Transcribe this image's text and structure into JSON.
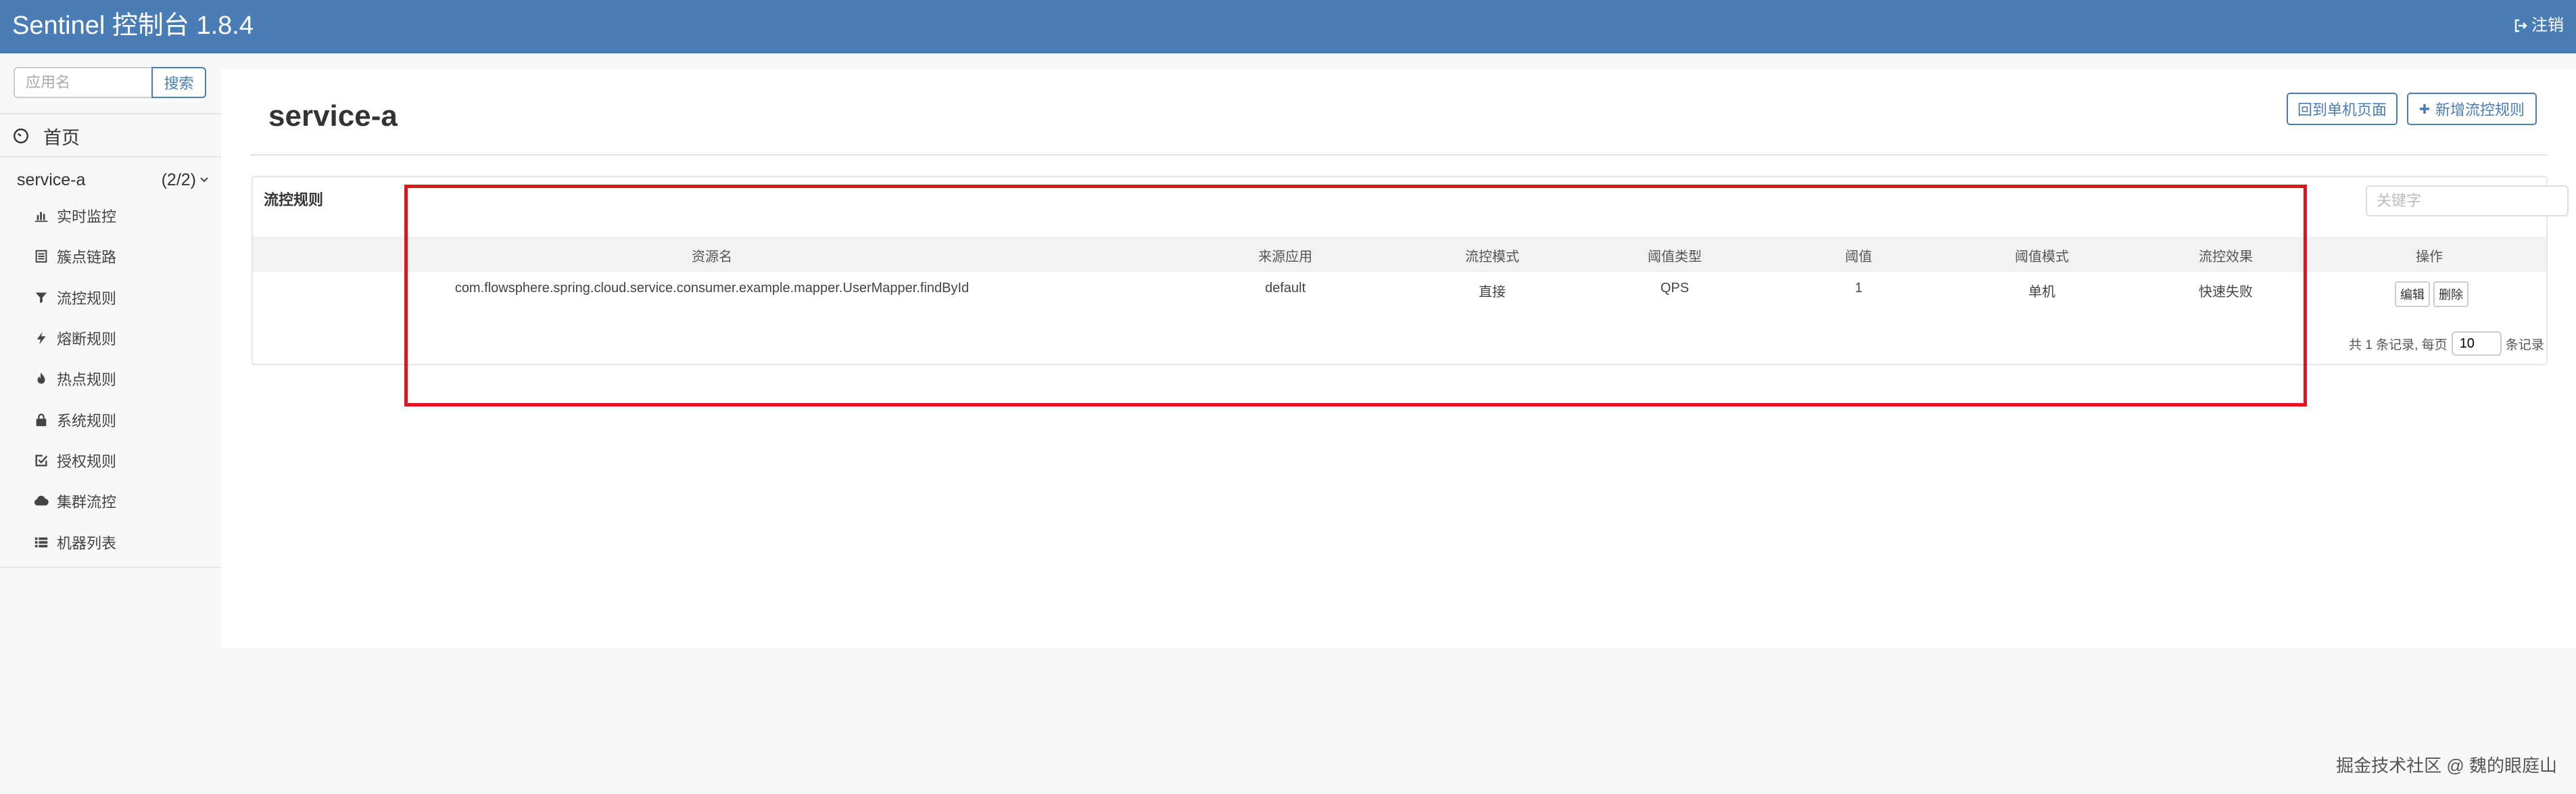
{
  "header": {
    "brand": "Sentinel 控制台 1.8.4",
    "logout_label": "注销"
  },
  "sidebar": {
    "search_placeholder": "应用名",
    "search_button": "搜索",
    "home_label": "首页",
    "app": {
      "name": "service-a",
      "count": "(2/2)"
    },
    "menu": [
      {
        "label": "实时监控",
        "icon": "bar-chart-icon"
      },
      {
        "label": "簇点链路",
        "icon": "list-icon"
      },
      {
        "label": "流控规则",
        "icon": "filter-icon"
      },
      {
        "label": "熔断规则",
        "icon": "flash-icon"
      },
      {
        "label": "热点规则",
        "icon": "fire-icon"
      },
      {
        "label": "系统规则",
        "icon": "lock-icon"
      },
      {
        "label": "授权规则",
        "icon": "check-square-icon"
      },
      {
        "label": "集群流控",
        "icon": "cloud-icon"
      },
      {
        "label": "机器列表",
        "icon": "list-icon"
      }
    ]
  },
  "main": {
    "title": "service-a",
    "back_button": "回到单机页面",
    "add_button": "新增流控规则",
    "panel_title": "流控规则",
    "keyword_placeholder": "关键字",
    "columns": [
      "资源名",
      "来源应用",
      "流控模式",
      "阈值类型",
      "阈值",
      "阈值模式",
      "流控效果",
      "操作"
    ],
    "rows": [
      {
        "resource": "com.flowsphere.spring.cloud.service.consumer.example.mapper.UserMapper.findById",
        "limit_app": "default",
        "strategy": "直接",
        "grade": "QPS",
        "count": "1",
        "cluster_mode": "单机",
        "control_behavior": "快速失败",
        "edit_label": "编辑",
        "delete_label": "删除"
      }
    ],
    "pager": {
      "total_prefix": "共 1 条记录, 每页",
      "page_size": "10",
      "suffix": "条记录"
    }
  },
  "watermark": "掘金技术社区 @ 魏的眼庭山",
  "colors": {
    "header_bg": "#4a7db5",
    "accent": "#4a7db5",
    "highlight": "#e0151b"
  }
}
